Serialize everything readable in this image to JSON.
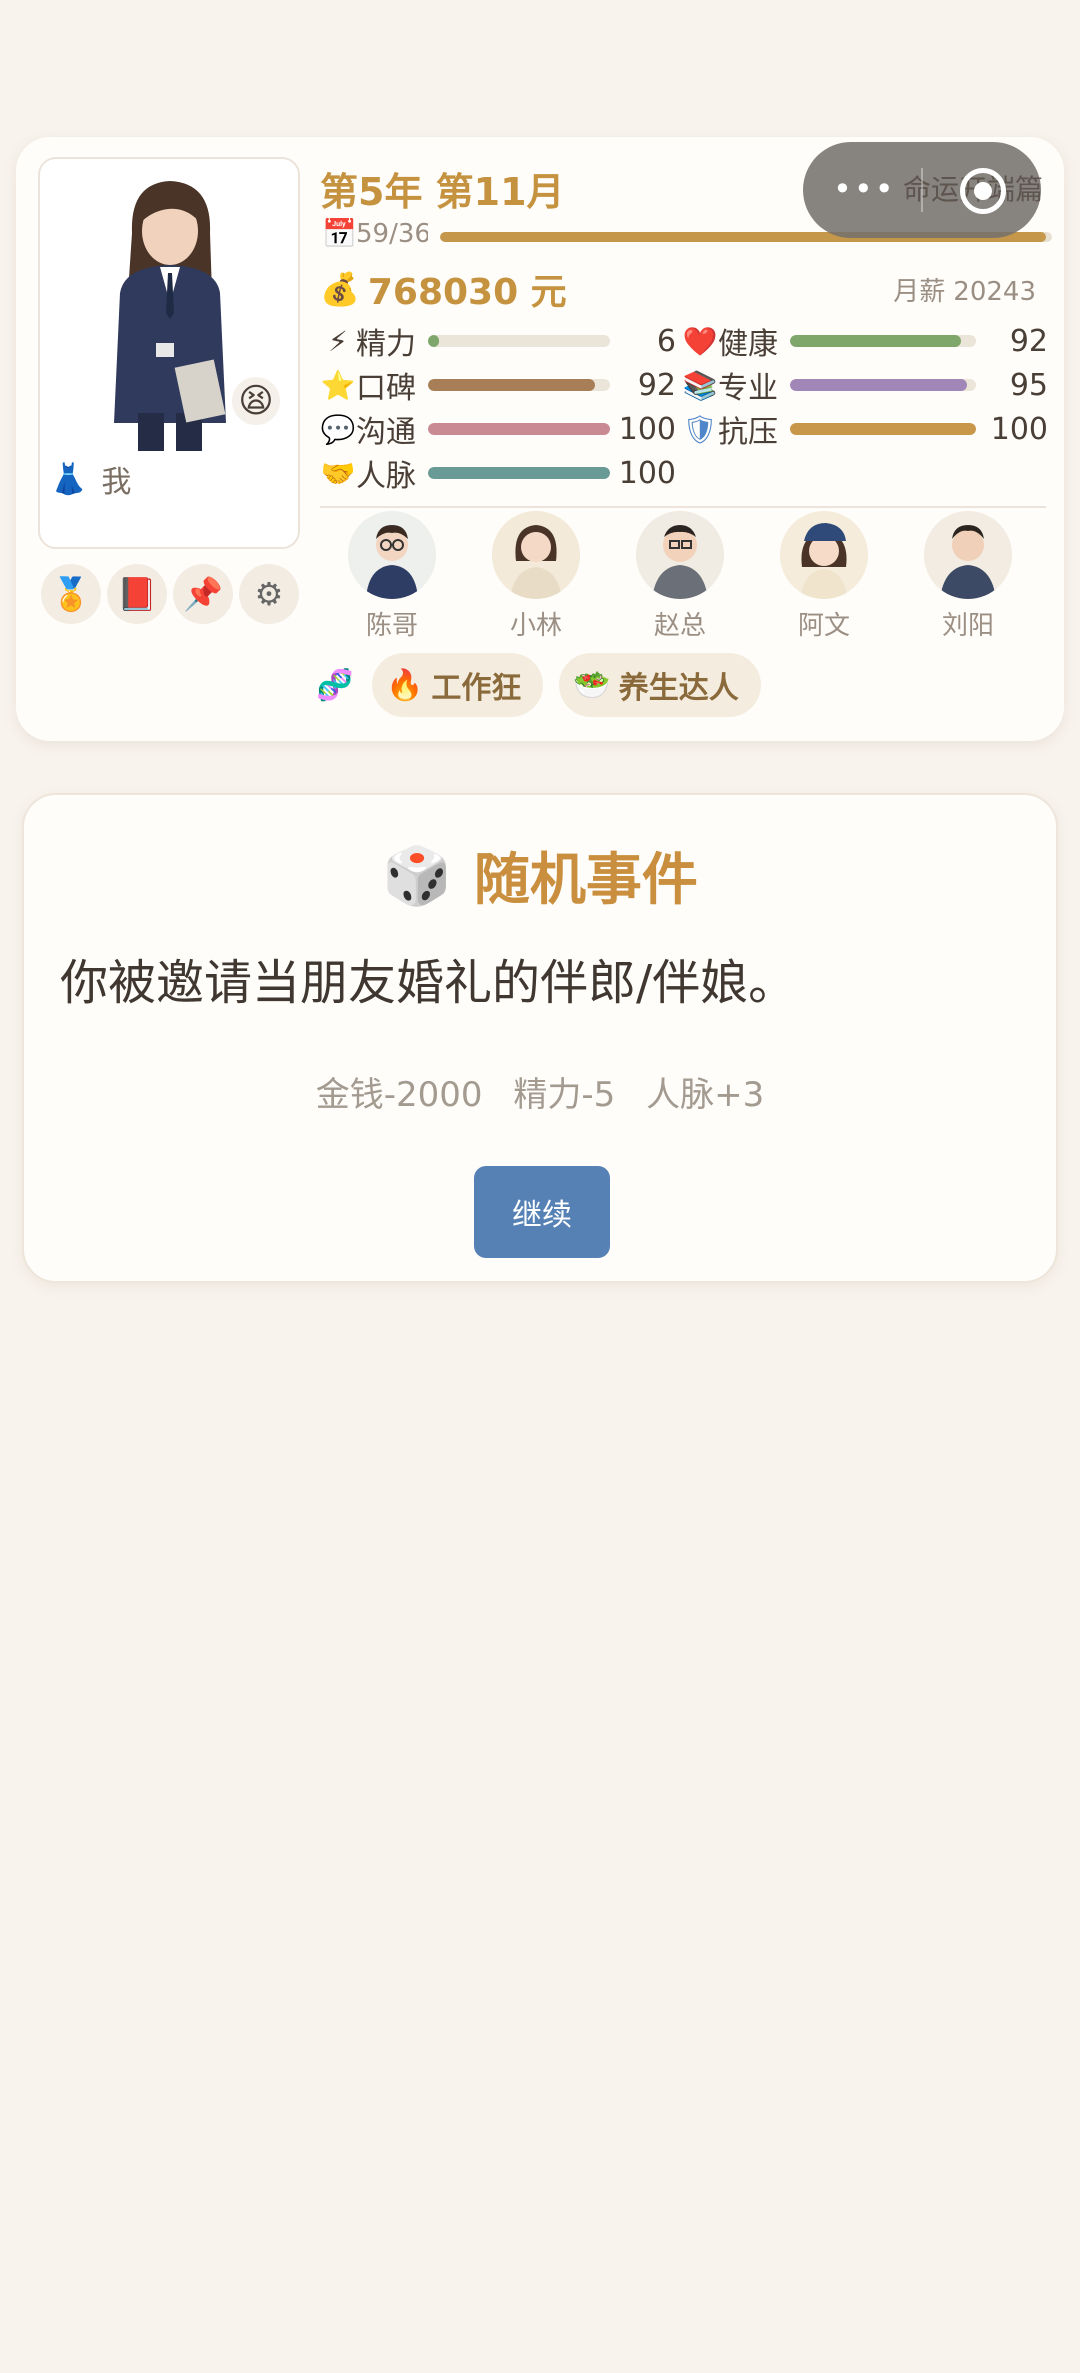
{
  "profile": {
    "name": "我",
    "dress_icon": "dress-icon",
    "mood_icon": "😫"
  },
  "tools": [
    {
      "name": "medal-icon",
      "glyph": "🏅"
    },
    {
      "name": "book-icon",
      "glyph": "📕"
    },
    {
      "name": "pushpin-icon",
      "glyph": "📌"
    },
    {
      "name": "gear-icon",
      "glyph": "⚙"
    }
  ],
  "status": {
    "turn_title": "第5年 第11月",
    "calendar_icon": "📅",
    "calendar_text": "59/36",
    "time_progress": 0.99,
    "money_icon": "💰",
    "money": "768030 元",
    "salary_label": "月薪",
    "salary_value": "20243"
  },
  "stats": [
    {
      "key": "energy",
      "icon": "⚡",
      "label": "精力",
      "value": "6",
      "fraction": 0.06,
      "color": "#7fa76b"
    },
    {
      "key": "health",
      "icon": "❤️",
      "label": "健康",
      "value": "92",
      "fraction": 0.92,
      "color": "#7fa76b"
    },
    {
      "key": "reputation",
      "icon": "⭐",
      "label": "口碑",
      "value": "92",
      "fraction": 0.92,
      "color": "#a87e56"
    },
    {
      "key": "expertise",
      "icon": "📚",
      "label": "专业",
      "value": "95",
      "fraction": 0.95,
      "color": "#a186b8"
    },
    {
      "key": "communication",
      "icon": "💬",
      "label": "沟通",
      "value": "100",
      "fraction": 1.0,
      "color": "#c98a94"
    },
    {
      "key": "stress",
      "icon": "🛡",
      "label": "抗压",
      "value": "100",
      "fraction": 1.0,
      "color": "#c8974a"
    },
    {
      "key": "network",
      "icon": "🤝",
      "label": "人脉",
      "value": "100",
      "fraction": 1.0,
      "color": "#6a9a96"
    }
  ],
  "contacts": [
    {
      "name": "陈哥"
    },
    {
      "name": "小林"
    },
    {
      "name": "赵总"
    },
    {
      "name": "阿文"
    },
    {
      "name": "刘阳"
    }
  ],
  "traits": {
    "dna_icon": "🧬",
    "items": [
      {
        "icon": "🔥",
        "label": "工作狂"
      },
      {
        "icon": "🥗",
        "label": "养生达人"
      }
    ]
  },
  "miniapp": {
    "title": "命运开端篇",
    "menu": "•••"
  },
  "event": {
    "dice_icon": "🎲",
    "title": "随机事件",
    "description": "你被邀请当朋友婚礼的伴郎/伴娘。",
    "effects": [
      "金钱-2000",
      "精力-5",
      "人脉+3"
    ],
    "continue_label": "继续"
  }
}
